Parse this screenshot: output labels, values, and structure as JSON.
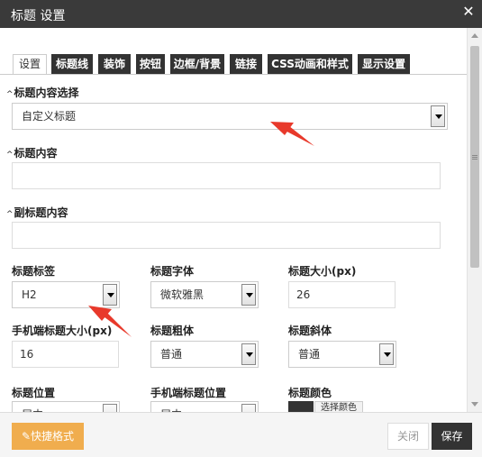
{
  "window": {
    "title": "标题 设置"
  },
  "tabs": [
    {
      "label": "设置",
      "active": true
    },
    {
      "label": "标题线"
    },
    {
      "label": "装饰"
    },
    {
      "label": "按钮"
    },
    {
      "label": "边框/背景"
    },
    {
      "label": "链接"
    },
    {
      "label": "CSS动画和样式"
    },
    {
      "label": "显示设置"
    }
  ],
  "fields": {
    "content_select": {
      "label": "标题内容选择",
      "value": "自定义标题"
    },
    "title_content": {
      "label": "标题内容",
      "value": ""
    },
    "subtitle_content": {
      "label": "副标题内容",
      "value": ""
    },
    "title_tag": {
      "label": "标题标签",
      "value": "H2"
    },
    "title_font": {
      "label": "标题字体",
      "value": "微软雅黑"
    },
    "title_size": {
      "label": "标题大小(px)",
      "value": "26"
    },
    "mobile_title_size": {
      "label": "手机端标题大小(px)",
      "value": "16"
    },
    "title_bold": {
      "label": "标题粗体",
      "value": "普通"
    },
    "title_italic": {
      "label": "标题斜体",
      "value": "普通"
    },
    "title_position": {
      "label": "标题位置",
      "value": "居中"
    },
    "mobile_title_position": {
      "label": "手机端标题位置",
      "value": "居中"
    },
    "title_color": {
      "label": "标题颜色",
      "button": "选择颜色",
      "color": "#333333"
    }
  },
  "footer": {
    "quick_format": "快捷格式",
    "close": "关闭",
    "save": "保存"
  },
  "colors": {
    "titlebar": "#3a3a3a",
    "tab": "#333333",
    "quick_button": "#f0ad4e",
    "save_button": "#333333",
    "annotation_arrow": "#e8392b"
  }
}
